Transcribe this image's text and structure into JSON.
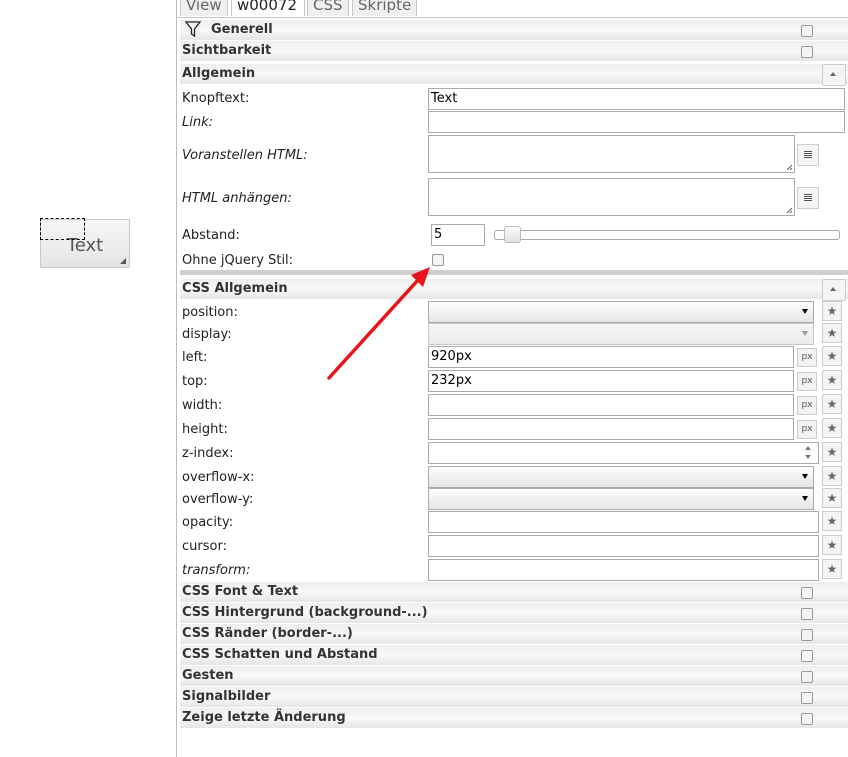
{
  "preview": {
    "button_text": "Text"
  },
  "tabs": [
    "View",
    "w00072",
    "CSS",
    "Skripte"
  ],
  "groups": {
    "generell": "Generell",
    "sichtbarkeit": "Sichtbarkeit",
    "allgemein": "Allgemein",
    "css_allgemein": "CSS Allgemein",
    "css_font": "CSS Font & Text",
    "css_hintergrund": "CSS Hintergrund (background-...)",
    "css_raender": "CSS Ränder (border-...)",
    "css_schatten": "CSS Schatten und Abstand",
    "gesten": "Gesten",
    "signalbilder": "Signalbilder",
    "zeige_letzte": "Zeige letzte Änderung"
  },
  "allgemein": {
    "knopftext_label": "Knopftext:",
    "knopftext_value": "Text",
    "link_label": "Link:",
    "voranstellen_label": "Voranstellen HTML:",
    "anhaengen_label": "HTML anhängen:",
    "abstand_label": "Abstand:",
    "abstand_value": "5",
    "ohne_jquery_label": "Ohne jQuery Stil:"
  },
  "css": {
    "position_label": "position:",
    "display_label": "display:",
    "left_label": "left:",
    "left_value": "920px",
    "top_label": "top:",
    "top_value": "232px",
    "width_label": "width:",
    "height_label": "height:",
    "zindex_label": "z-index:",
    "overflowx_label": "overflow-x:",
    "overflowy_label": "overflow-y:",
    "opacity_label": "opacity:",
    "cursor_label": "cursor:",
    "transform_label": "transform:",
    "unit_px": "px"
  },
  "icons": {
    "favorite": "star-icon",
    "filter": "funnel-icon",
    "edit": "edit-icon"
  },
  "colors": {
    "arrow": "#e8141b",
    "group_bg": "#eeeeee"
  }
}
